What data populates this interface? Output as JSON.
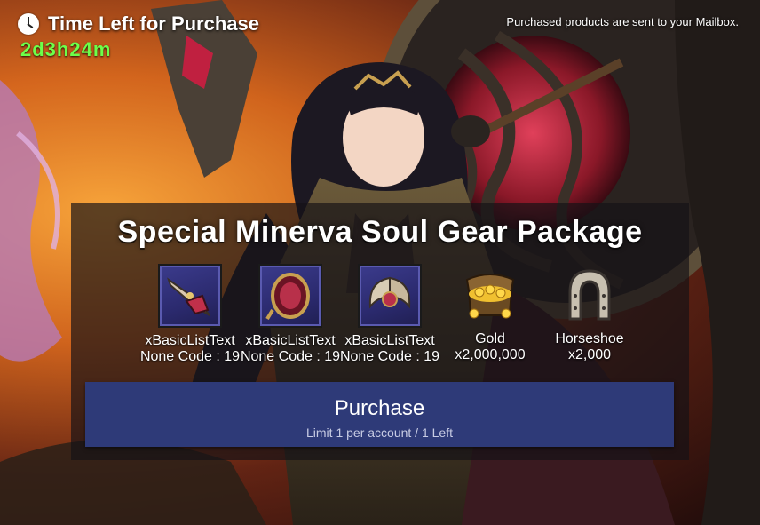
{
  "timer": {
    "title": "Time Left for Purchase",
    "value": "2d3h24m",
    "icon": "clock-icon"
  },
  "notice": {
    "mailbox": "Purchased products are sent to your Mailbox."
  },
  "package": {
    "title": "Special Minerva Soul Gear Package",
    "items": [
      {
        "name": "xBasicListText",
        "qty": "None Code : 19",
        "icon": "soul-gear-weapon-icon"
      },
      {
        "name": "xBasicListText",
        "qty": "None Code : 19",
        "icon": "soul-gear-mirror-icon"
      },
      {
        "name": "xBasicListText",
        "qty": "None Code : 19",
        "icon": "soul-gear-wings-icon"
      },
      {
        "name": "Gold",
        "qty": "x2,000,000",
        "icon": "gold-chest-icon"
      },
      {
        "name": "Horseshoe",
        "qty": "x2,000",
        "icon": "horseshoe-icon"
      }
    ]
  },
  "purchase": {
    "label": "Purchase",
    "sub": "Limit 1 per account / 1 Left"
  },
  "colors": {
    "timer_value": "#6cff4a",
    "button": "#2e3a78",
    "item_frame": "#2b2a6e"
  }
}
